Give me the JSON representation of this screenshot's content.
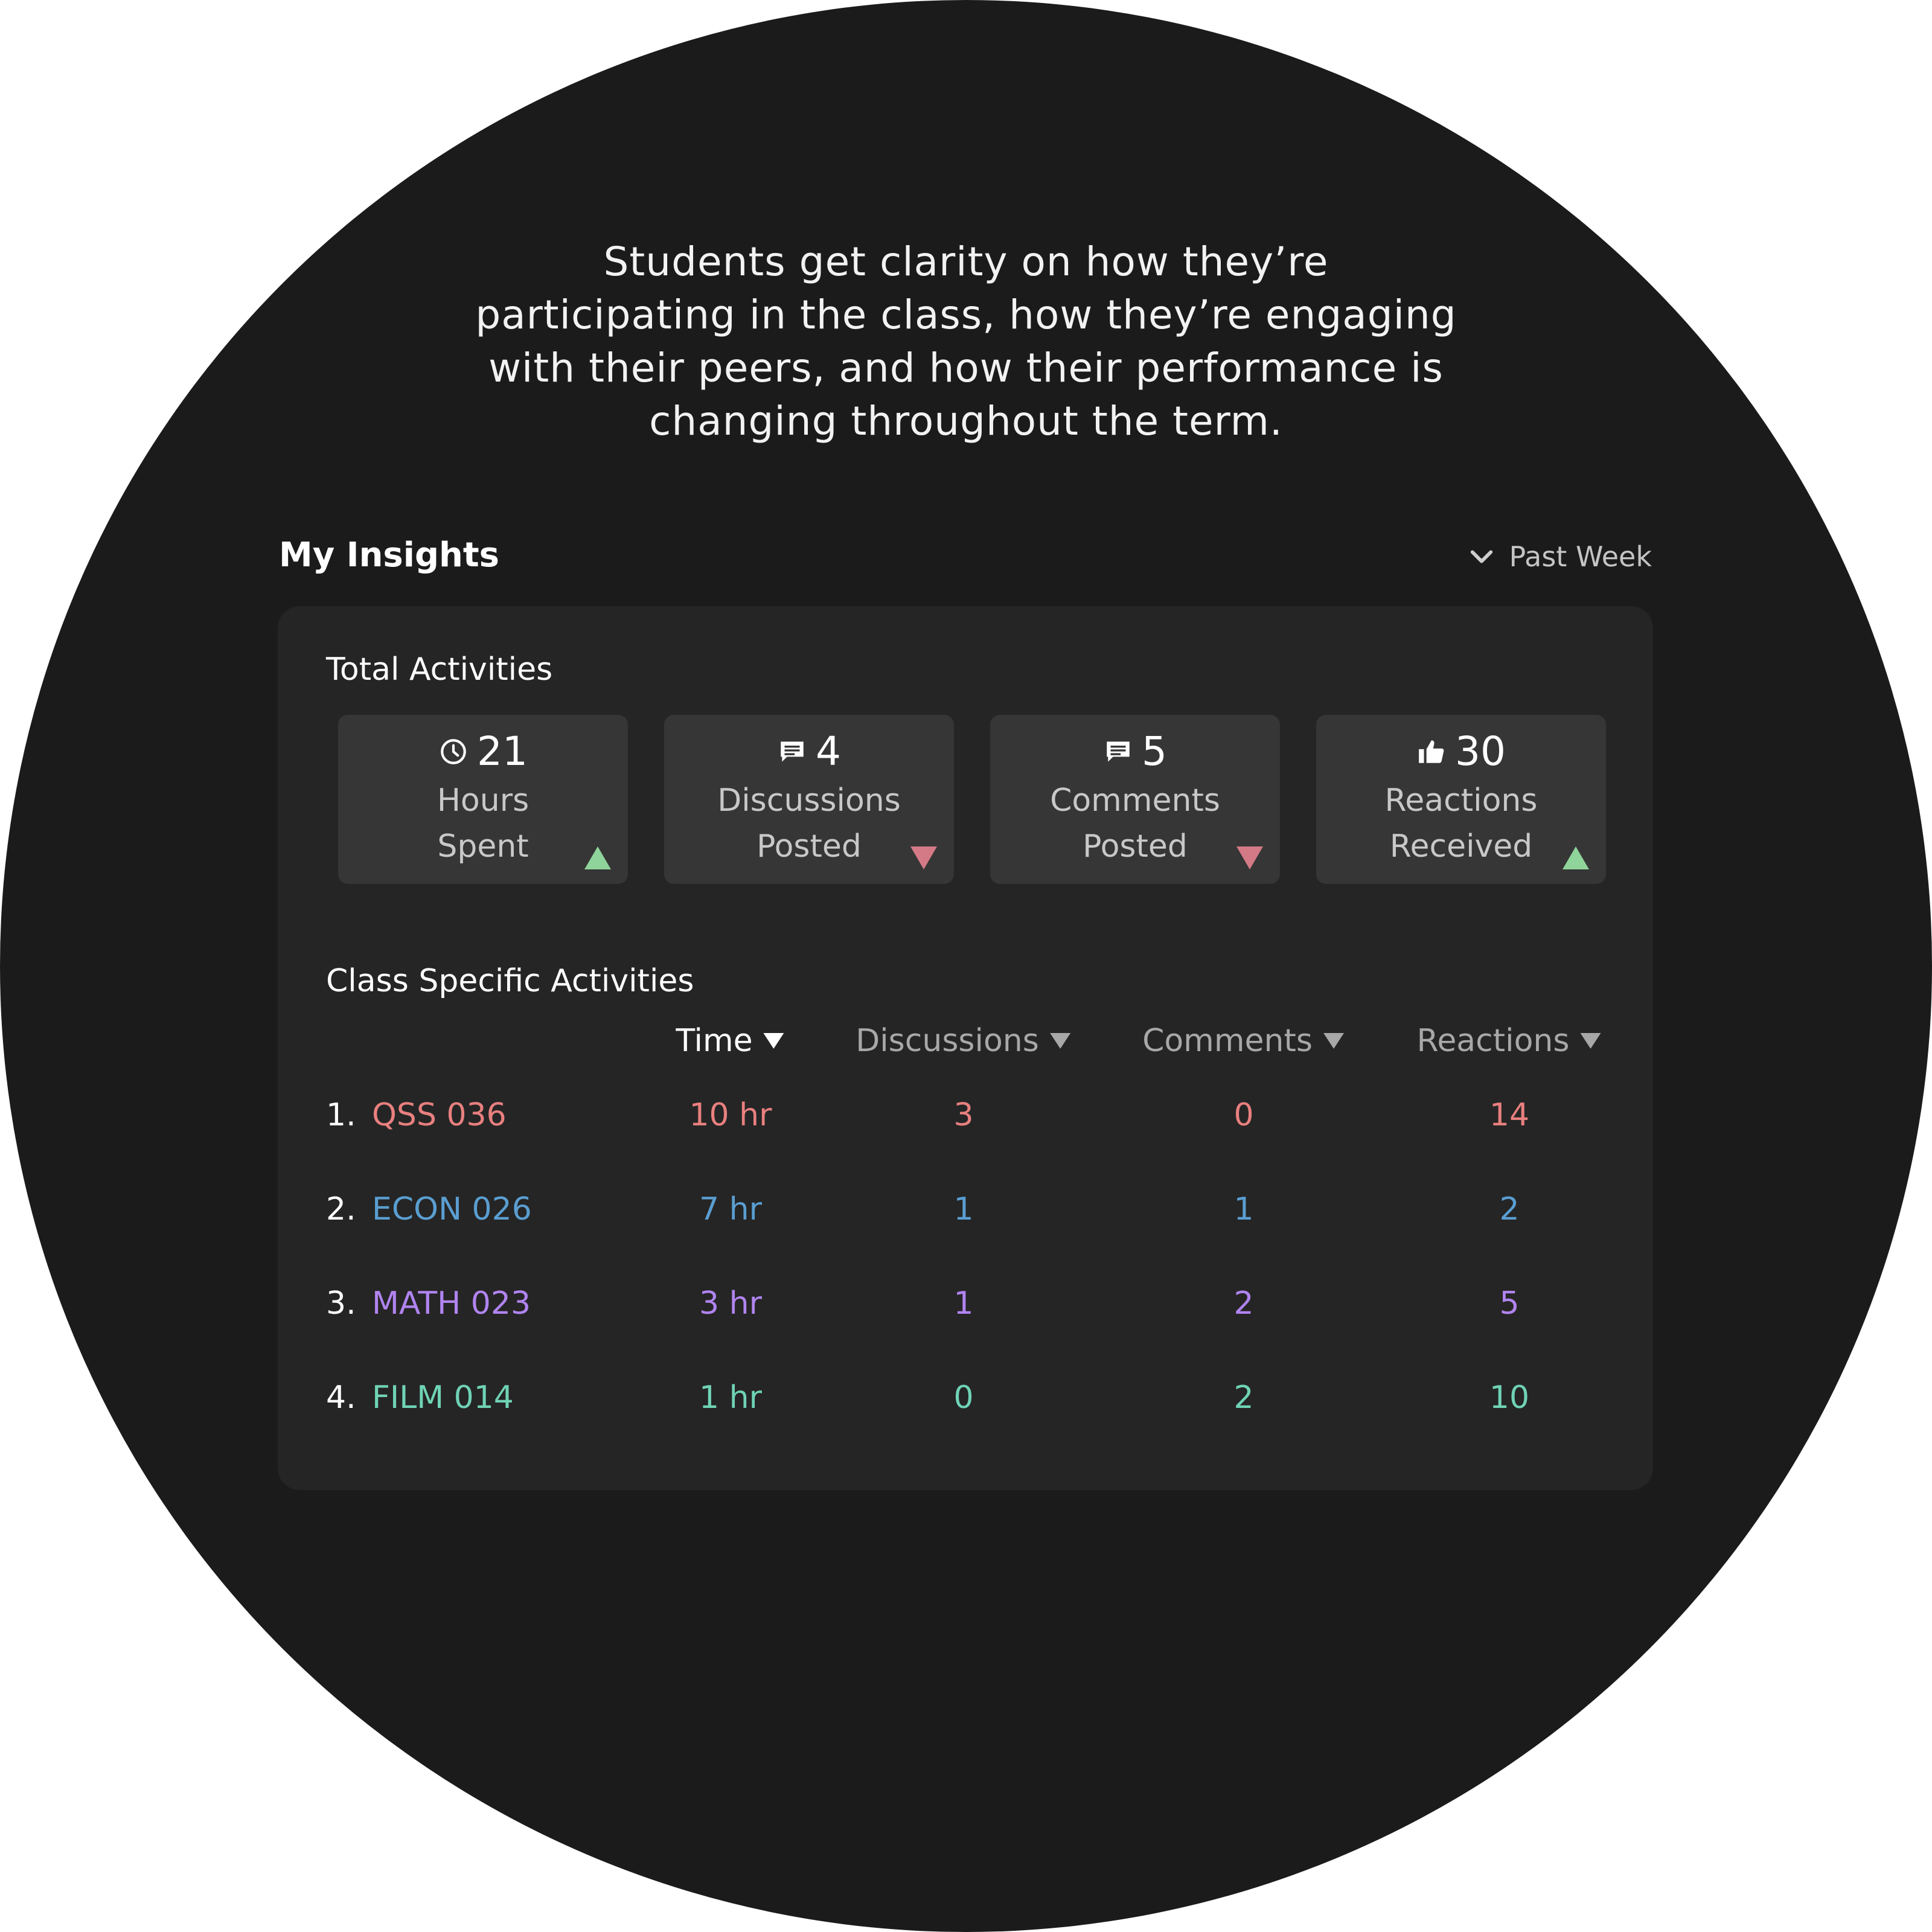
{
  "tagline": {
    "line1": "Students get clarity on how they’re",
    "line2": "participating in the class, how they’re engaging",
    "line3": "with their peers, and how their performance is",
    "line4": "changing throughout the term."
  },
  "header": {
    "title": "My Insights",
    "period_label": "Past Week",
    "period_icon": "chevron-down-icon"
  },
  "totals": {
    "title": "Total Activities",
    "tiles": [
      {
        "icon": "clock-icon",
        "value": "21",
        "label_line1": "Hours",
        "label_line2": "Spent",
        "trend": "up"
      },
      {
        "icon": "chat-icon",
        "value": "4",
        "label_line1": "Discussions",
        "label_line2": "Posted",
        "trend": "down"
      },
      {
        "icon": "chat-icon",
        "value": "5",
        "label_line1": "Comments",
        "label_line2": "Posted",
        "trend": "down"
      },
      {
        "icon": "thumbs-up-icon",
        "value": "30",
        "label_line1": "Reactions",
        "label_line2": "Received",
        "trend": "up"
      }
    ]
  },
  "class_activities": {
    "title": "Class Specific Activities",
    "columns": {
      "time": "Time",
      "discussions": "Discussions",
      "comments": "Comments",
      "reactions": "Reactions"
    },
    "sorted_by": "time",
    "rows": [
      {
        "index": "1.",
        "course": "QSS 036",
        "time": "10 hr",
        "discussions": "3",
        "comments": "0",
        "reactions": "14",
        "color": "#e8807f"
      },
      {
        "index": "2.",
        "course": "ECON 026",
        "time": "7 hr",
        "discussions": "1",
        "comments": "1",
        "reactions": "2",
        "color": "#5a9ed1"
      },
      {
        "index": "3.",
        "course": "MATH 023",
        "time": "3 hr",
        "discussions": "1",
        "comments": "2",
        "reactions": "5",
        "color": "#b184f0"
      },
      {
        "index": "4.",
        "course": "FILM 014",
        "time": "1 hr",
        "discussions": "0",
        "comments": "2",
        "reactions": "10",
        "color": "#6fd3b5"
      }
    ]
  },
  "colors": {
    "background": "#1b1b1b",
    "card": "#252525",
    "tile": "#363636",
    "trend_up": "#8fd49a",
    "trend_down": "#d47a86"
  }
}
